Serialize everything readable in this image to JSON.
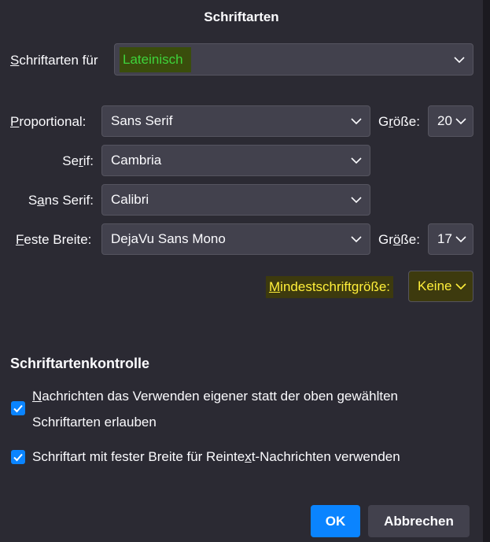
{
  "dialog": {
    "title": "Schriftarten",
    "fonts_for": {
      "label_pre": "",
      "label_ul": "S",
      "label_post": "chriftarten für",
      "value": "Lateinisch"
    },
    "proportional": {
      "label_ul": "P",
      "label_post": "roportional:",
      "value": "Sans Serif",
      "size_label_pre": "G",
      "size_label_ul": "r",
      "size_label_post": "öße:",
      "size_value": "20"
    },
    "serif": {
      "label_pre": "Se",
      "label_ul": "r",
      "label_post": "if:",
      "value": "Cambria"
    },
    "sans_serif": {
      "label_pre": "S",
      "label_ul": "a",
      "label_post": "ns Serif:",
      "value": "Calibri"
    },
    "fixed_width": {
      "label_ul": "F",
      "label_post": "este Breite:",
      "value": "DejaVu Sans Mono",
      "size_label_pre": "Gr",
      "size_label_ul": "ö",
      "size_label_post": "ße:",
      "size_value": "17"
    },
    "min_size": {
      "label_ul": "M",
      "label_post": "indestschriftgröße:",
      "value": "Keine"
    },
    "font_control": {
      "title": "Schriftartenkontrolle",
      "allow_own": {
        "checked": true,
        "line1_ul": "N",
        "line1_post": "achrichten das Verwenden eigener statt der oben gewählten",
        "line2": "Schriftarten erlauben"
      },
      "fixed_plain": {
        "checked": true,
        "text_pre": "Schriftart mit fester Breite für Reinte",
        "text_ul": "x",
        "text_post": "t-Nachrichten verwenden"
      }
    },
    "buttons": {
      "ok": "OK",
      "cancel": "Abbrechen"
    }
  },
  "colors": {
    "accent": "#0a84ff",
    "background": "#2b2a33",
    "field": "#42414d",
    "highlight_green": "#3ed33b",
    "highlight_yellow": "#ffef3a"
  },
  "icons": [
    "chevron-down-icon",
    "checkmark-icon"
  ]
}
